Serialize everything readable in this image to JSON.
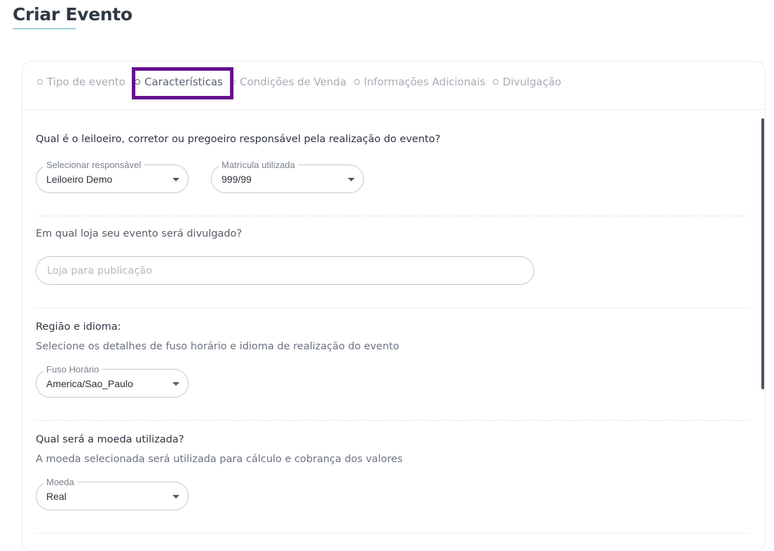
{
  "page": {
    "title": "Criar Evento"
  },
  "stepper": {
    "steps": [
      {
        "label": "Tipo de evento"
      },
      {
        "label": "Características"
      },
      {
        "label": "Condições de Venda"
      },
      {
        "label": "Informações Adicionais"
      },
      {
        "label": "Divulgação"
      }
    ],
    "active_index": 1
  },
  "responsavel": {
    "question": "Qual é o leiloeiro, corretor ou pregoeiro responsável pela realização do evento?",
    "responsible_select": {
      "label": "Selecionar responsável",
      "value": "Leiloeiro Demo"
    },
    "registration_select": {
      "label": "Matrícula utilizada",
      "value": "999/99"
    }
  },
  "loja": {
    "question": "Em qual loja seu evento será divulgado?",
    "input": {
      "placeholder": "Loja para publicação",
      "value": ""
    }
  },
  "regiao": {
    "question": "Região e idioma:",
    "description": "Selecione os detalhes de fuso horário e idioma de realização do evento",
    "timezone_select": {
      "label": "Fuso Horário",
      "value": "America/Sao_Paulo"
    }
  },
  "moeda": {
    "question": "Qual será a moeda utilizada?",
    "description": "A moeda selecionada será utilizada para cálculo e cobrança dos valores",
    "currency_select": {
      "label": "Moeda",
      "value": "Real"
    }
  },
  "colors": {
    "highlight": "#660f8f",
    "title_underline": "#9fd3e0",
    "inactive_step": "#a7adb5"
  }
}
